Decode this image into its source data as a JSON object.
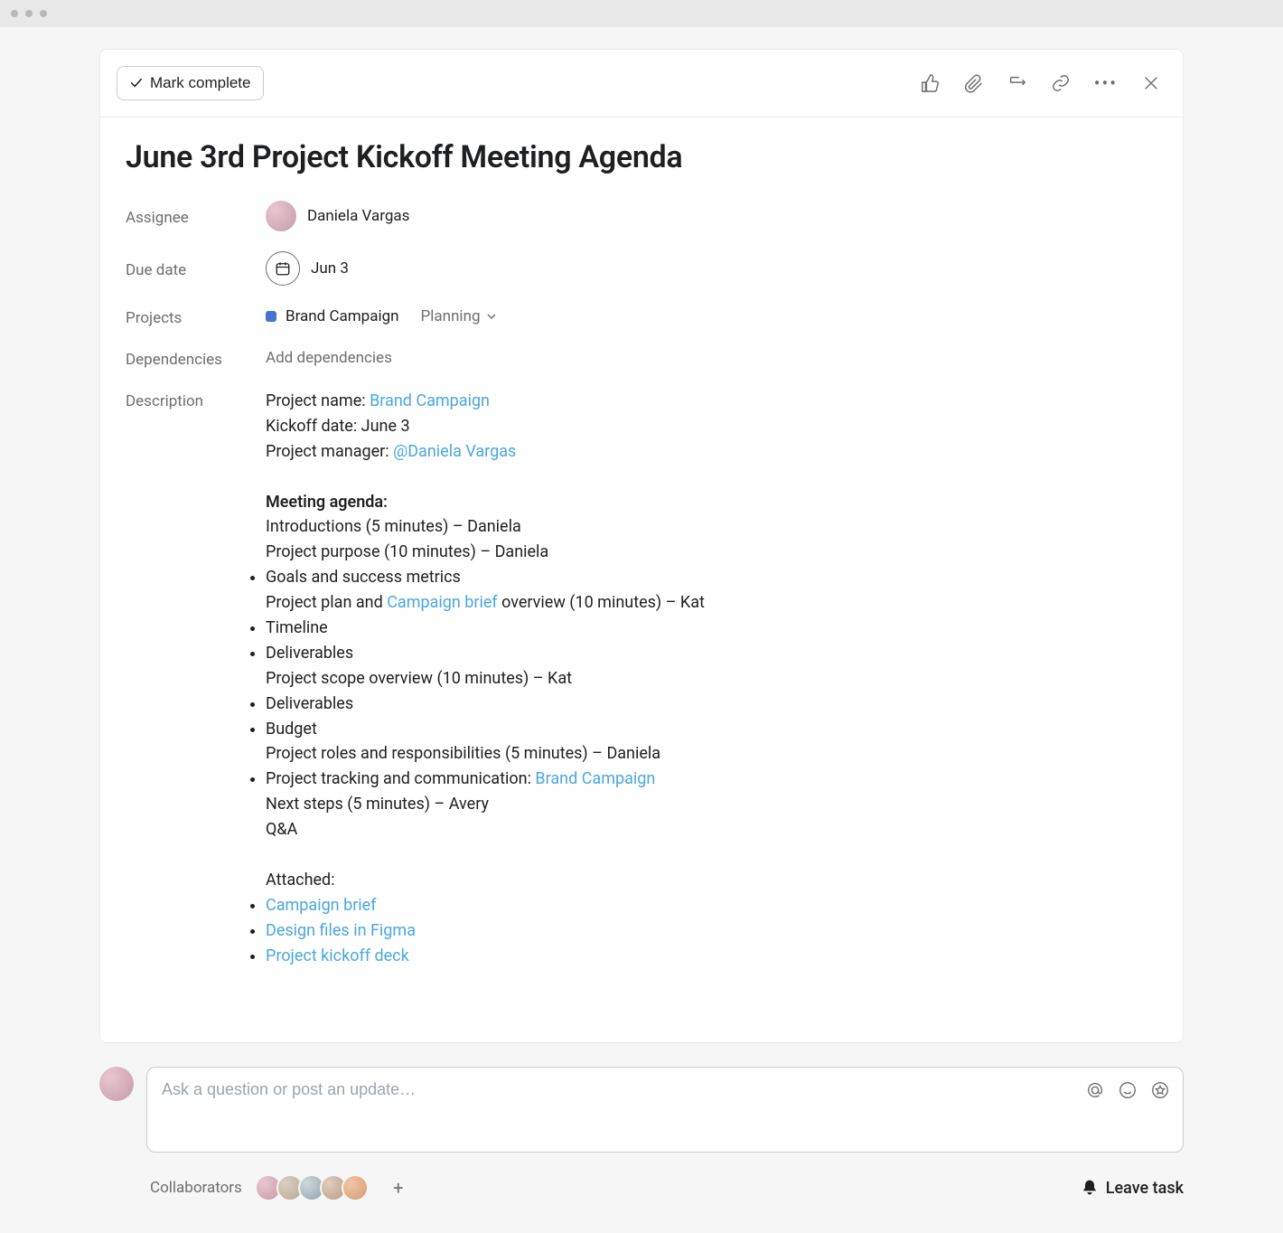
{
  "header": {
    "mark_complete": "Mark complete"
  },
  "task": {
    "title": "June 3rd Project Kickoff Meeting Agenda"
  },
  "fields": {
    "assignee_label": "Assignee",
    "assignee_value": "Daniela Vargas",
    "due_label": "Due date",
    "due_value": "Jun 3",
    "projects_label": "Projects",
    "project_name": "Brand Campaign",
    "project_section": "Planning",
    "deps_label": "Dependencies",
    "deps_value": "Add dependencies",
    "desc_label": "Description"
  },
  "description": {
    "project_name_label": "Project name: ",
    "project_name_link": "Brand Campaign",
    "kickoff": "Kickoff date: June 3",
    "pm_label": "Project manager: ",
    "pm_link": "@Daniela Vargas",
    "agenda_heading": "Meeting agenda:",
    "item1": "Introductions (5 minutes) – Daniela",
    "item2": "Project purpose (10 minutes) – Daniela",
    "item2a": "Goals and success metrics",
    "item3_prefix": "Project plan and ",
    "item3_link": "Campaign brief",
    "item3_suffix": " overview (10 minutes) – Kat",
    "item3a": "Timeline",
    "item3b": "Deliverables",
    "item4": "Project scope overview (10 minutes) – Kat",
    "item4a": "Deliverables",
    "item4b": "Budget",
    "item5": "Project roles and responsibilities (5 minutes) – Daniela",
    "item5a_prefix": "Project tracking and communication: ",
    "item5a_link": "Brand Campaign",
    "item6": "Next steps (5 minutes) – Avery",
    "item7": "Q&A",
    "attached_heading": "Attached:",
    "att1": "Campaign brief",
    "att2": "Design files in Figma",
    "att3": "Project kickoff deck"
  },
  "comment": {
    "placeholder": "Ask a question or post an update…"
  },
  "footer": {
    "collab_label": "Collaborators",
    "leave_label": "Leave task"
  }
}
